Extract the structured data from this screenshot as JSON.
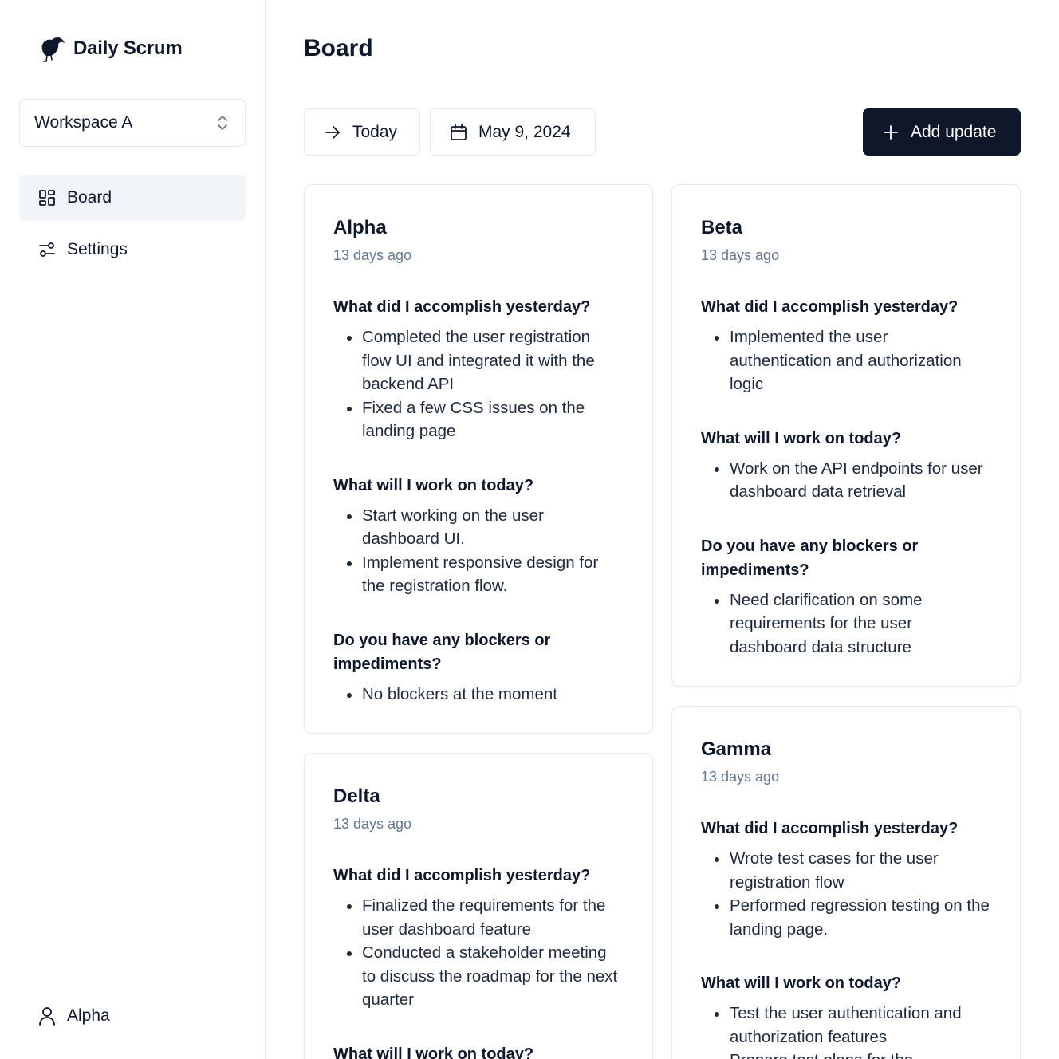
{
  "app": {
    "name": "Daily Scrum"
  },
  "sidebar": {
    "workspace": "Workspace A",
    "nav": [
      {
        "label": "Board",
        "active": true,
        "icon": "board-icon"
      },
      {
        "label": "Settings",
        "active": false,
        "icon": "settings-icon"
      }
    ],
    "user": "Alpha"
  },
  "page": {
    "title": "Board"
  },
  "toolbar": {
    "today_label": "Today",
    "date_label": "May 9, 2024",
    "add_label": "Add update"
  },
  "cards": [
    {
      "name": "Alpha",
      "ago": "13 days ago",
      "sections": [
        {
          "question": "What did I accomplish yesterday?",
          "items": [
            "Completed the user registration flow UI and integrated it with the backend API",
            "Fixed a few CSS issues on the landing page"
          ]
        },
        {
          "question": "What will I work on today?",
          "items": [
            "Start working on the user dashboard UI.",
            "Implement responsive design for the registration flow."
          ]
        },
        {
          "question": "Do you have any blockers or impediments?",
          "items": [
            "No blockers at the moment"
          ]
        }
      ]
    },
    {
      "name": "Beta",
      "ago": "13 days ago",
      "sections": [
        {
          "question": "What did I accomplish yesterday?",
          "items": [
            "Implemented the user authentication and authorization logic"
          ]
        },
        {
          "question": "What will I work on today?",
          "items": [
            "Work on the API endpoints for user dashboard data retrieval"
          ]
        },
        {
          "question": "Do you have any blockers or impediments?",
          "items": [
            "Need clarification on some requirements for the user dashboard data structure"
          ]
        }
      ]
    },
    {
      "name": "Delta",
      "ago": "13 days ago",
      "sections": [
        {
          "question": "What did I accomplish yesterday?",
          "items": [
            "Finalized the requirements for the user dashboard feature",
            "Conducted a stakeholder meeting to discuss the roadmap for the next quarter"
          ]
        },
        {
          "question": "What will I work on today?",
          "items": []
        }
      ]
    },
    {
      "name": "Gamma",
      "ago": "13 days ago",
      "sections": [
        {
          "question": "What did I accomplish yesterday?",
          "items": [
            "Wrote test cases for the user registration flow",
            "Performed regression testing on the landing page."
          ]
        },
        {
          "question": "What will I work on today?",
          "items": [
            "Test the user authentication and authorization features",
            "Prepare test plans for the"
          ]
        }
      ]
    }
  ]
}
